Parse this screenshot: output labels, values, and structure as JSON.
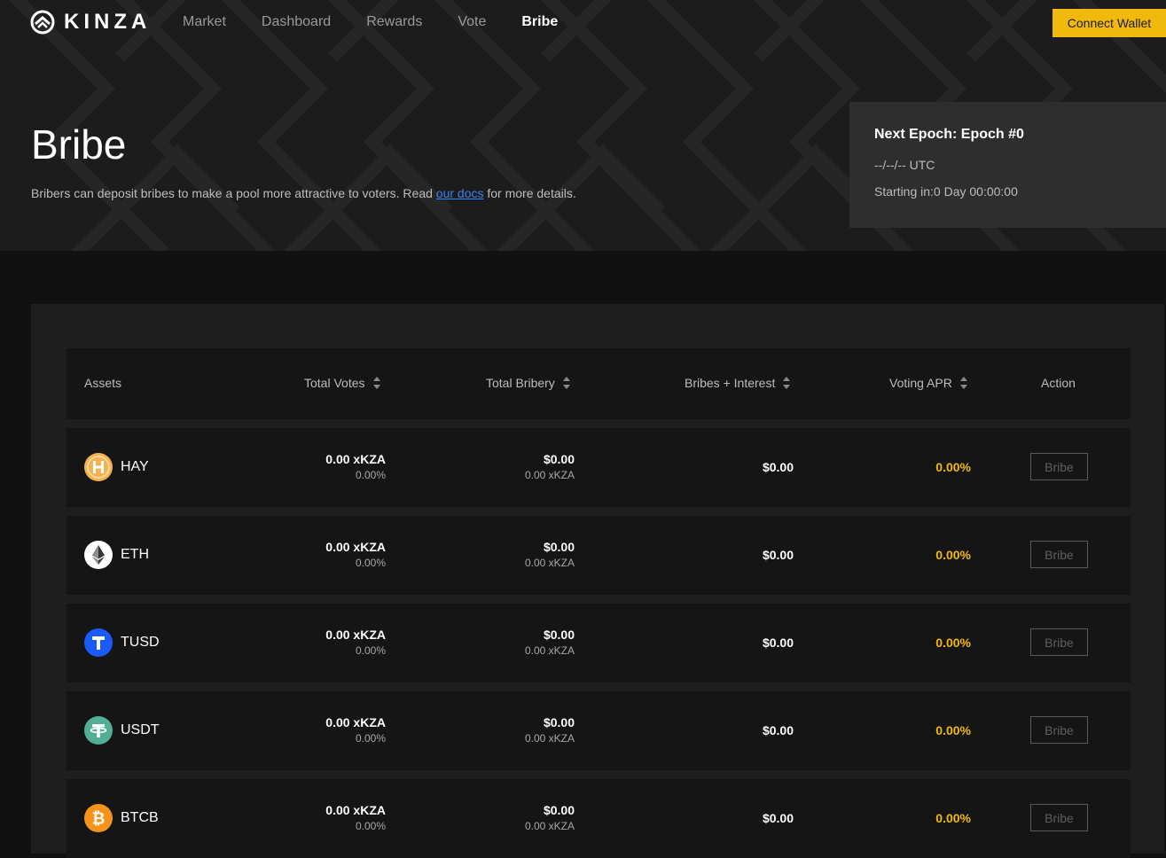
{
  "brand": {
    "name": "KINZA"
  },
  "nav": {
    "links": [
      "Market",
      "Dashboard",
      "Rewards",
      "Vote",
      "Bribe"
    ],
    "active_index": 4,
    "connect_wallet": "Connect Wallet"
  },
  "hero": {
    "title": "Bribe",
    "desc_before": "Bribers can deposit bribes to make a pool more attractive to voters. Read ",
    "desc_link": "our docs",
    "desc_after": " for more details."
  },
  "epoch": {
    "title": "Next Epoch: Epoch #0",
    "date": "--/--/-- UTC",
    "starting": "Starting in:0 Day 00:00:00"
  },
  "table": {
    "headers": {
      "assets": "Assets",
      "total_votes": "Total Votes",
      "total_bribery": "Total Bribery",
      "bribes_interest": "Bribes + Interest",
      "voting_apr": "Voting APR",
      "action": "Action"
    },
    "rows": [
      {
        "asset": "HAY",
        "icon": "hay-coin-icon",
        "votes": "0.00 xKZA",
        "votes_pct": "0.00%",
        "bribery": "$0.00",
        "bribery_sub": "0.00 xKZA",
        "bribes_interest": "$0.00",
        "apr": "0.00%",
        "action": "Bribe"
      },
      {
        "asset": "ETH",
        "icon": "eth-coin-icon",
        "votes": "0.00 xKZA",
        "votes_pct": "0.00%",
        "bribery": "$0.00",
        "bribery_sub": "0.00 xKZA",
        "bribes_interest": "$0.00",
        "apr": "0.00%",
        "action": "Bribe"
      },
      {
        "asset": "TUSD",
        "icon": "tusd-coin-icon",
        "votes": "0.00 xKZA",
        "votes_pct": "0.00%",
        "bribery": "$0.00",
        "bribery_sub": "0.00 xKZA",
        "bribes_interest": "$0.00",
        "apr": "0.00%",
        "action": "Bribe"
      },
      {
        "asset": "USDT",
        "icon": "usdt-coin-icon",
        "votes": "0.00 xKZA",
        "votes_pct": "0.00%",
        "bribery": "$0.00",
        "bribery_sub": "0.00 xKZA",
        "bribes_interest": "$0.00",
        "apr": "0.00%",
        "action": "Bribe"
      },
      {
        "asset": "BTCB",
        "icon": "btcb-coin-icon",
        "votes": "0.00 xKZA",
        "votes_pct": "0.00%",
        "bribery": "$0.00",
        "bribery_sub": "0.00 xKZA",
        "bribes_interest": "$0.00",
        "apr": "0.00%",
        "action": "Bribe"
      }
    ]
  },
  "colors": {
    "accent": "#f0b90b",
    "background": "#111111",
    "panel": "#1e1e1e",
    "row": "#151515",
    "link": "#3b82f6"
  }
}
